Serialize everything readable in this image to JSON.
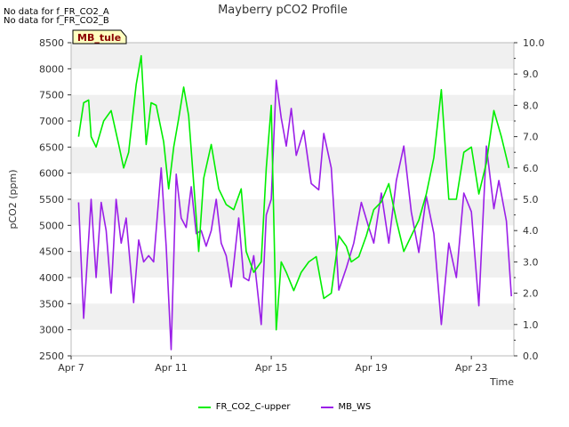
{
  "notes": [
    "No data for f_FR_CO2_A",
    "No data for f_FR_CO2_B"
  ],
  "badge": "MB_tule",
  "colors": {
    "series_green": "#00ee00",
    "series_purple": "#9b1fe8",
    "band": "#f0f0f0",
    "badge_bg": "#ffffc0",
    "badge_text": "#8b0000"
  },
  "chart_data": {
    "type": "line",
    "title": "Mayberry pCO2 Profile",
    "xlabel": "Time",
    "ylabel": "pCO2 (ppm)",
    "y2label": "",
    "x_ticks": [
      "Apr 7",
      "Apr 11",
      "Apr 15",
      "Apr 19",
      "Apr 23"
    ],
    "x_tick_days": [
      7,
      11,
      15,
      19,
      23
    ],
    "xlim": [
      7,
      24.7
    ],
    "ylim": [
      2500,
      8500
    ],
    "y_ticks": [
      2500,
      3000,
      3500,
      4000,
      4500,
      5000,
      5500,
      6000,
      6500,
      7000,
      7500,
      8000,
      8500
    ],
    "y2lim": [
      0,
      10
    ],
    "y2_ticks": [
      "0.0",
      "1.0",
      "2.0",
      "3.0",
      "4.0",
      "5.0",
      "6.0",
      "7.0",
      "8.0",
      "9.0",
      "10.0"
    ],
    "series": [
      {
        "name": "FR_CO2_C-upper",
        "axis": "left",
        "x": [
          7.3,
          7.5,
          7.7,
          7.8,
          8.0,
          8.3,
          8.6,
          8.9,
          9.1,
          9.3,
          9.6,
          9.8,
          10.0,
          10.2,
          10.4,
          10.7,
          10.9,
          11.1,
          11.3,
          11.5,
          11.7,
          11.9,
          12.1,
          12.3,
          12.6,
          12.9,
          13.2,
          13.5,
          13.8,
          14.0,
          14.3,
          14.6,
          14.8,
          15.0,
          15.2,
          15.4,
          15.6,
          15.9,
          16.2,
          16.5,
          16.8,
          17.1,
          17.4,
          17.7,
          18.0,
          18.2,
          18.5,
          18.8,
          19.1,
          19.4,
          19.7,
          20.0,
          20.3,
          20.6,
          20.9,
          21.2,
          21.5,
          21.8,
          22.1,
          22.4,
          22.7,
          23.0,
          23.3,
          23.6,
          23.9,
          24.2,
          24.5
        ],
        "y": [
          6700,
          7350,
          7400,
          6700,
          6500,
          7000,
          7200,
          6550,
          6100,
          6400,
          7700,
          8250,
          6550,
          7350,
          7300,
          6600,
          5700,
          6500,
          7050,
          7650,
          7100,
          5800,
          4500,
          5900,
          6550,
          5700,
          5400,
          5300,
          5700,
          4500,
          4100,
          4300,
          6100,
          7300,
          3000,
          4300,
          4100,
          3750,
          4100,
          4300,
          4400,
          3600,
          3700,
          4800,
          4600,
          4300,
          4400,
          4800,
          5300,
          5450,
          5800,
          5100,
          4500,
          4800,
          5100,
          5600,
          6300,
          7600,
          5500,
          5500,
          6400,
          6500,
          5600,
          6200,
          7200,
          6700,
          6100
        ]
      },
      {
        "name": "MB_WS",
        "axis": "right",
        "x": [
          7.3,
          7.5,
          7.8,
          8.0,
          8.2,
          8.4,
          8.6,
          8.8,
          9.0,
          9.2,
          9.5,
          9.7,
          9.9,
          10.1,
          10.3,
          10.6,
          10.8,
          11.0,
          11.2,
          11.4,
          11.6,
          11.8,
          12.0,
          12.2,
          12.4,
          12.6,
          12.8,
          13.0,
          13.2,
          13.4,
          13.7,
          13.9,
          14.1,
          14.3,
          14.6,
          14.8,
          15.0,
          15.2,
          15.4,
          15.6,
          15.8,
          16.0,
          16.3,
          16.6,
          16.9,
          17.1,
          17.4,
          17.7,
          18.0,
          18.3,
          18.6,
          18.9,
          19.1,
          19.4,
          19.7,
          20.0,
          20.3,
          20.6,
          20.9,
          21.2,
          21.5,
          21.8,
          22.1,
          22.4,
          22.7,
          23.0,
          23.3,
          23.6,
          23.9,
          24.1,
          24.4,
          24.6
        ],
        "y": [
          4.9,
          1.2,
          5.0,
          2.5,
          4.9,
          4.0,
          2.0,
          5.0,
          3.6,
          4.4,
          1.7,
          3.7,
          3.0,
          3.2,
          3.0,
          6.0,
          3.5,
          0.2,
          5.8,
          4.4,
          4.1,
          5.4,
          3.9,
          4.0,
          3.5,
          4.0,
          5.0,
          3.6,
          3.2,
          2.2,
          4.4,
          2.5,
          2.4,
          3.2,
          1.0,
          4.5,
          5.0,
          8.8,
          7.6,
          6.7,
          7.9,
          6.4,
          7.2,
          5.5,
          5.3,
          7.1,
          6.0,
          2.1,
          2.8,
          3.6,
          4.9,
          4.1,
          3.6,
          5.2,
          3.6,
          5.6,
          6.7,
          4.6,
          3.3,
          5.1,
          3.9,
          1.0,
          3.6,
          2.5,
          5.2,
          4.6,
          1.6,
          6.7,
          4.7,
          5.6,
          4.3,
          1.9
        ]
      }
    ],
    "legend_position": "bottom-center",
    "grid": "horizontal-bands"
  }
}
